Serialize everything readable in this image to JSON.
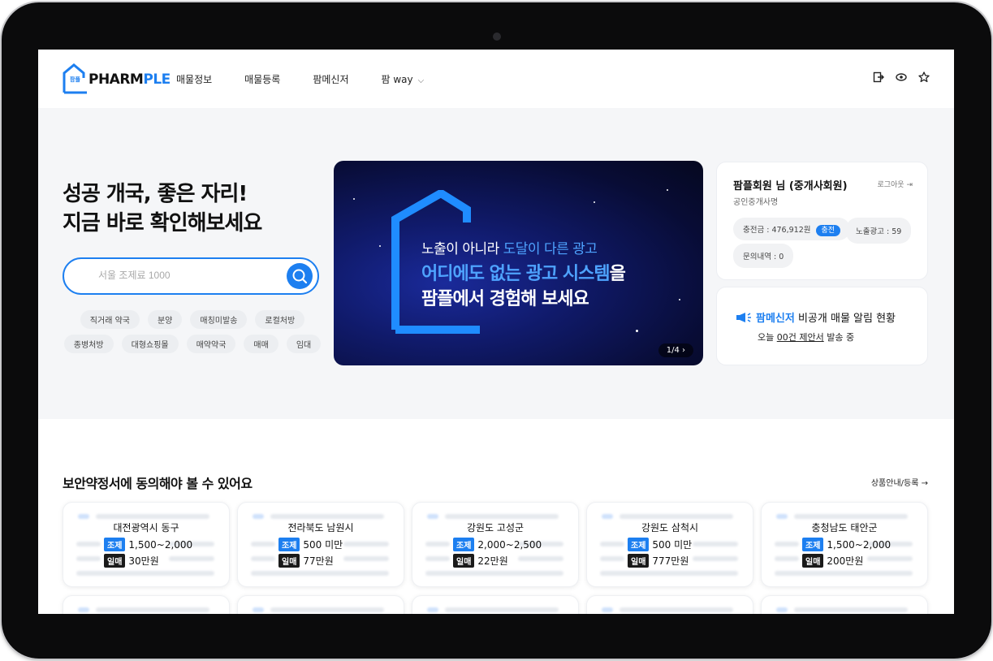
{
  "header": {
    "logo_small": "팜플",
    "logo_main_a": "PHARM",
    "logo_main_b": "PLE",
    "nav": [
      "매물정보",
      "매물등록",
      "팜메신저",
      "팜 way"
    ]
  },
  "hero": {
    "title_line1": "성공 개국, 좋은 자리!",
    "title_line2": "지금 바로 확인해보세요",
    "search_placeholder": "서울 조제료 1000",
    "tags_row1": [
      "직거래 약국",
      "분양",
      "매칭미발송",
      "로컬처방"
    ],
    "tags_row2": [
      "종병처방",
      "대형쇼핑몰",
      "매약약국",
      "매매",
      "임대"
    ]
  },
  "banner": {
    "line1_a": "노출이 아니라 ",
    "line1_b": "도달이 다른 광고",
    "line2_a": "어디에도 없는 광고 시스템",
    "line2_b": "을",
    "line3": "팜플에서 경험해 보세요",
    "pager": "1/4"
  },
  "profile": {
    "name": "팜플회원 님 (중개사회원)",
    "type": "공인중개사명",
    "logout": "로그아웃",
    "balance": "충전금 : 476,912원",
    "charge_label": "충전",
    "ads": "노출광고 : 59",
    "inquiries": "문의내역 : 0"
  },
  "messenger": {
    "title_a": "팜메신저",
    "title_b": " 비공개 매물 알림 현황",
    "sub_a": "오늘 ",
    "sub_b": "00건 제안서",
    "sub_c": " 발송 중"
  },
  "listings": {
    "title": "보안약정서에 동의해야 볼 수 있어요",
    "link": "상품안내/등록",
    "badge_a": "조제",
    "badge_b": "일매",
    "items": [
      {
        "region": "대전광역시 동구",
        "dispense": "1,500~2,000",
        "daily": "30만원"
      },
      {
        "region": "전라북도 남원시",
        "dispense": "500 미만",
        "daily": "77만원"
      },
      {
        "region": "강원도 고성군",
        "dispense": "2,000~2,500",
        "daily": "22만원"
      },
      {
        "region": "강원도 삼척시",
        "dispense": "500 미만",
        "daily": "777만원"
      },
      {
        "region": "충청남도 태안군",
        "dispense": "1,500~2,000",
        "daily": "200만원"
      }
    ]
  },
  "colors": {
    "accent": "#1d7ff0",
    "dark": "#1a1a1a"
  }
}
